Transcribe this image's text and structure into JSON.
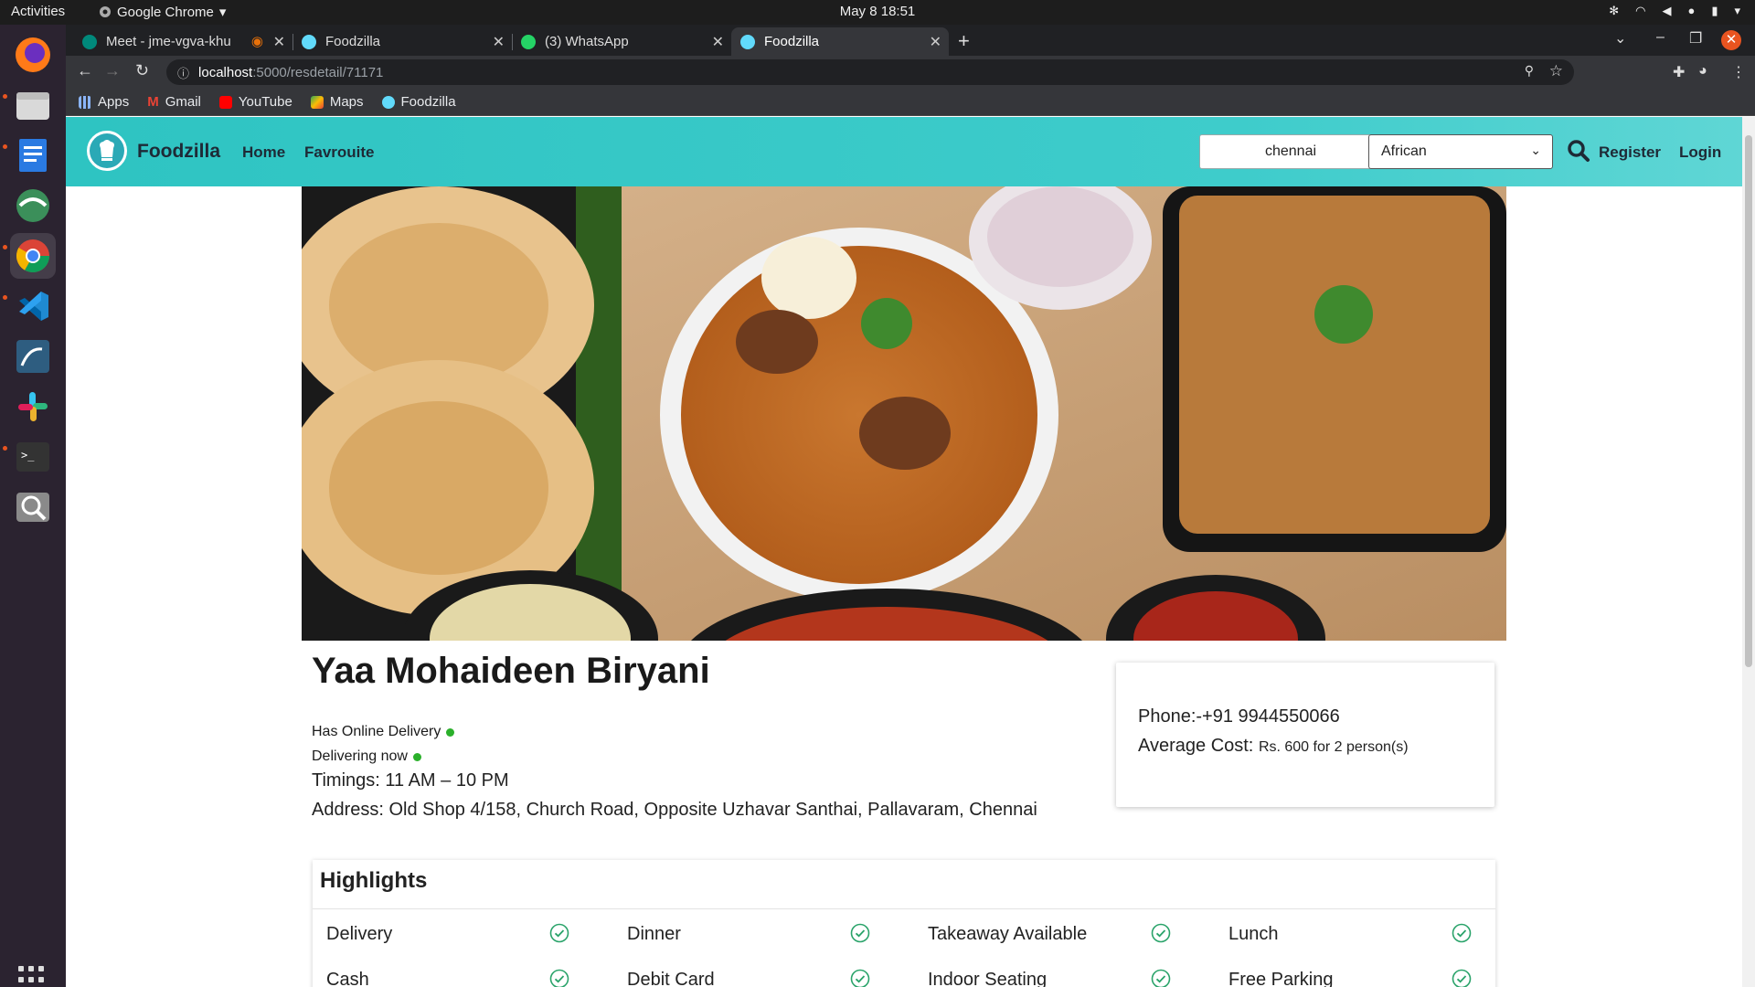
{
  "os": {
    "activities": "Activities",
    "app_menu": "Google Chrome",
    "clock": "May 8  18:51"
  },
  "browser": {
    "tabs": [
      {
        "title": "Meet - jme-vgva-khu",
        "favicon": "meet-icon"
      },
      {
        "title": "Foodzilla",
        "favicon": "react-icon"
      },
      {
        "title": "(3) WhatsApp",
        "favicon": "whatsapp-icon"
      },
      {
        "title": "Foodzilla",
        "favicon": "react-icon",
        "active": true
      }
    ],
    "url_host": "localhost",
    "url_path": ":5000/resdetail/71171",
    "bookmarks": [
      {
        "label": "Apps",
        "icon": "apps-grid-icon"
      },
      {
        "label": "Gmail",
        "icon": "gmail-icon"
      },
      {
        "label": "YouTube",
        "icon": "youtube-icon"
      },
      {
        "label": "Maps",
        "icon": "maps-icon"
      },
      {
        "label": "Foodzilla",
        "icon": "react-icon"
      }
    ]
  },
  "site": {
    "brand": "Foodzilla",
    "nav": {
      "home": "Home",
      "favourite": "Favrouite"
    },
    "search_value": "chennai",
    "cuisine_selected": "African",
    "register": "Register",
    "login": "Login",
    "accent_color": "#2ec4c2"
  },
  "restaurant": {
    "name": "Yaa Mohaideen Biryani",
    "online_delivery": "Has Online Delivery",
    "delivering_now": "Delivering now",
    "timings": "Timings: 11 AM – 10 PM",
    "address": "Address: Old Shop 4/158, Church Road, Opposite Uzhavar Santhai, Pallavaram, Chennai",
    "phone": "Phone:-+91 9944550066",
    "avg_cost_label": "Average Cost:",
    "avg_cost_value": "Rs. 600 for 2 person(s)"
  },
  "highlights": {
    "title": "Highlights",
    "items": [
      "Delivery",
      "Dinner",
      "Takeaway Available",
      "Lunch",
      "Cash",
      "Debit Card",
      "Indoor Seating",
      "Free Parking"
    ]
  }
}
